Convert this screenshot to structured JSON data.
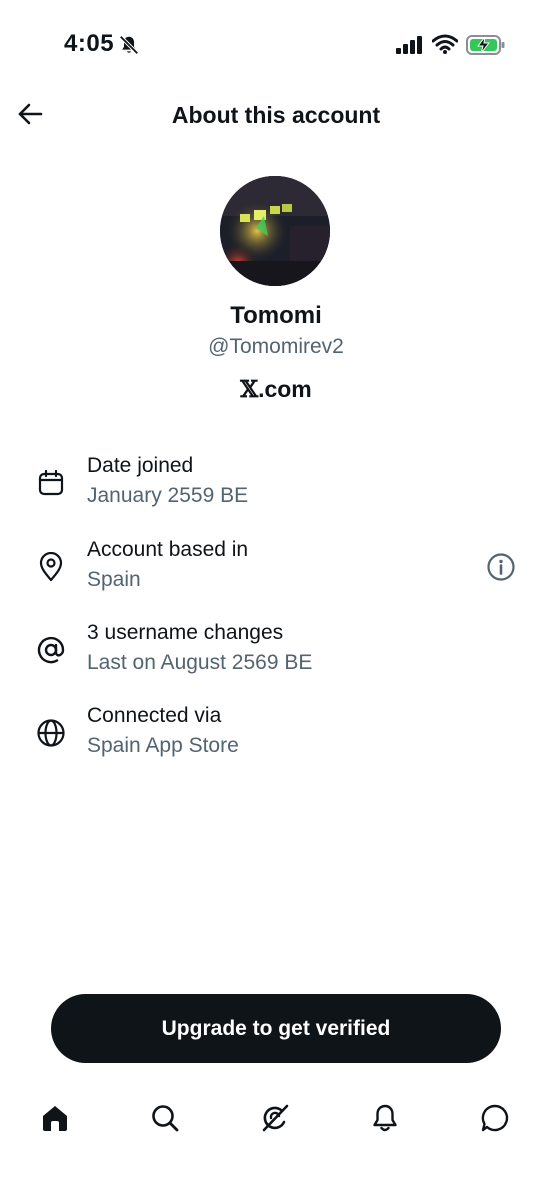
{
  "status_bar": {
    "time": "4:05"
  },
  "header": {
    "title": "About this account"
  },
  "profile": {
    "display_name": "Tomomi",
    "handle": "@Tomomirev2",
    "site_glyph": "𝕏",
    "site_suffix": ".com"
  },
  "details": [
    {
      "icon": "calendar-icon",
      "title": "Date joined",
      "subtitle": "January 2559 BE"
    },
    {
      "icon": "location-pin-icon",
      "title": "Account based in",
      "subtitle": "Spain"
    },
    {
      "icon": "at-sign-icon",
      "title": "3 username changes",
      "subtitle": "Last on August 2569 BE"
    },
    {
      "icon": "globe-icon",
      "title": "Connected via",
      "subtitle": "Spain App Store"
    }
  ],
  "cta": {
    "label": "Upgrade to get verified"
  },
  "tabs": [
    {
      "icon": "home-icon",
      "active": true
    },
    {
      "icon": "search-icon",
      "active": false
    },
    {
      "icon": "grok-icon",
      "active": false
    },
    {
      "icon": "bell-icon",
      "active": false
    },
    {
      "icon": "messages-icon",
      "active": false
    }
  ],
  "colors": {
    "text_primary": "#0f1419",
    "text_secondary": "#536471",
    "button_bg": "#0f1419",
    "battery_green": "#34c759"
  }
}
